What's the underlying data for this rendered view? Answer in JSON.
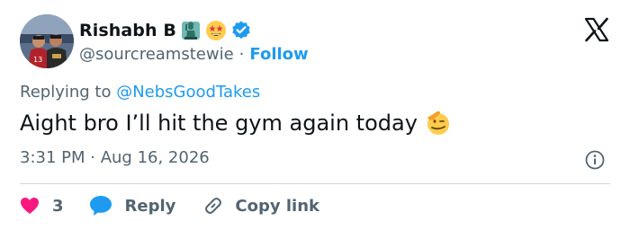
{
  "author": {
    "display_name": "Rishabh B",
    "handle": "@sourcreamstewie",
    "separator": "·",
    "follow_label": "Follow"
  },
  "reply_context": {
    "prefix": "Replying to ",
    "mention": "@NebsGoodTakes"
  },
  "tweet": {
    "text": "Aight bro I’ll hit the gym again today"
  },
  "meta": {
    "time": "3:31 PM",
    "separator": " · ",
    "date": "Aug 16, 2026"
  },
  "actions": {
    "like_count": "3",
    "reply_label": "Reply",
    "copy_label": "Copy link"
  },
  "colors": {
    "accent": "#1d9bf0",
    "like": "#f91880",
    "text": "#0f1419",
    "muted": "#536471"
  },
  "icons": [
    "x-logo-icon",
    "statue-of-liberty-icon",
    "star-struck-icon",
    "verified-badge-icon",
    "saluting-face-icon",
    "info-icon",
    "heart-icon",
    "reply-bubble-icon",
    "link-icon"
  ]
}
